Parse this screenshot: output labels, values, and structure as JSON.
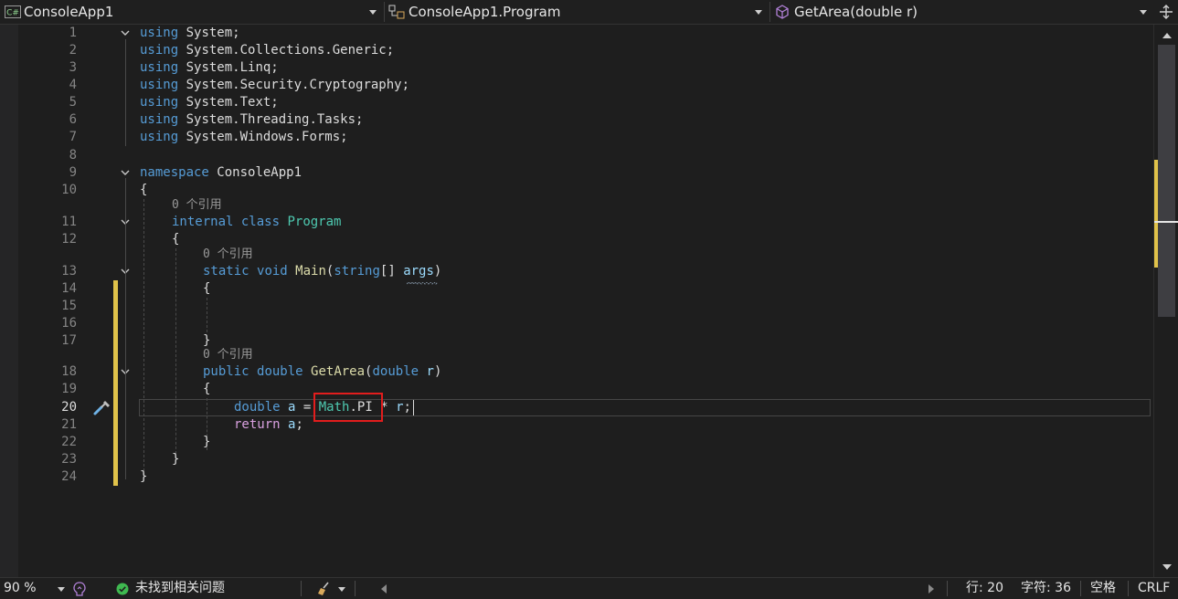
{
  "navbar": {
    "project": "ConsoleApp1",
    "project_icon_text": "C#",
    "class_scope": "ConsoleApp1.Program",
    "member": "GetArea(double r)"
  },
  "gutter": {
    "line_numbers": [
      "1",
      "2",
      "3",
      "4",
      "5",
      "6",
      "7",
      "8",
      "9",
      "10",
      "11",
      "12",
      "13",
      "14",
      "15",
      "16",
      "17",
      "18",
      "19",
      "20",
      "21",
      "22",
      "23",
      "24"
    ],
    "current_line": "20"
  },
  "code": {
    "l1_kw": "using",
    "l1_ns": "System;",
    "l2_kw": "using",
    "l2_ns": "System.Collections.Generic;",
    "l3_kw": "using",
    "l3_ns": "System.Linq;",
    "l4_kw": "using",
    "l4_ns": "System.Security.Cryptography;",
    "l5_kw": "using",
    "l5_ns": "System.Text;",
    "l6_kw": "using",
    "l6_ns": "System.Threading.Tasks;",
    "l7_kw": "using",
    "l7_ns": "System.Windows.Forms;",
    "l9_kw": "namespace",
    "l9_name": "ConsoleApp1",
    "l10": "{",
    "lens_class": "0 个引用",
    "l11_kw1": "internal",
    "l11_kw2": "class",
    "l11_type": "Program",
    "l12": "{",
    "lens_main": "0 个引用",
    "l13_kw1": "static",
    "l13_kw2": "void",
    "l13_fn": "Main",
    "l13_p1": "(",
    "l13_kw3": "string",
    "l13_p2": "[] ",
    "l13_param": "args",
    "l13_p3": ")",
    "l14": "{",
    "l17": "}",
    "lens_getarea": "0 个引用",
    "l18_kw1": "public",
    "l18_kw2": "double",
    "l18_fn": "GetArea",
    "l18_p1": "(",
    "l18_kw3": "double",
    "l18_param": "r",
    "l18_p2": ")",
    "l19": "{",
    "l20_kw": "double",
    "l20_var": "a",
    "l20_eq": " = ",
    "l20_type": "Math",
    "l20_dot": ".",
    "l20_member": "PI",
    "l20_rest": " * ",
    "l20_param": "r",
    "l20_end": ";",
    "l21_kw": "return",
    "l21_var": "a",
    "l21_end": ";",
    "l22": "}",
    "l23": "}",
    "l24": "}"
  },
  "statusbar": {
    "zoom": "90 %",
    "issues": "未找到相关问题",
    "line": "行: 20",
    "char": "字符: 36",
    "whitespace": "空格",
    "line_ending": "CRLF"
  },
  "colors": {
    "background": "#1e1e1e",
    "keyword": "#569cd6",
    "control_keyword": "#d8a0df",
    "type": "#4ec9b0",
    "function": "#dcdcaa",
    "parameter": "#9cdcfe",
    "change_marker": "#e0c24a",
    "highlight_box": "#e21d1d",
    "ok_status": "#3fb950"
  }
}
